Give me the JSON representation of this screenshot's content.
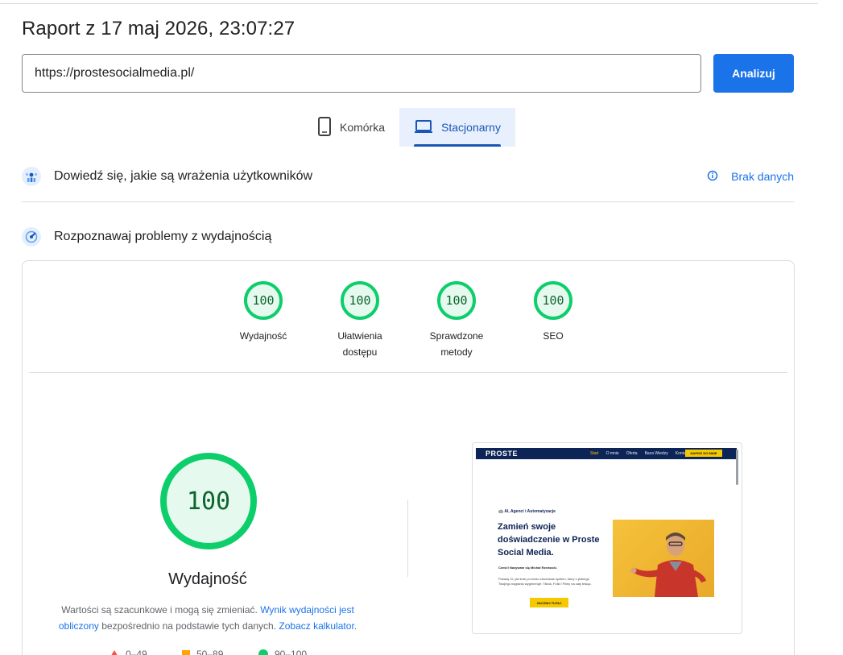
{
  "header": {
    "title": "Raport z 17 maj 2026, 23:07:27"
  },
  "search": {
    "url_value": "https://prostesocialmedia.pl/",
    "analyze_label": "Analizuj"
  },
  "tabs": [
    {
      "label": "Komórka",
      "icon": "phone-icon",
      "active": false
    },
    {
      "label": "Stacjonarny",
      "icon": "laptop-icon",
      "active": true
    }
  ],
  "sections": {
    "field_data": {
      "title": "Dowiedź się, jakie są wrażenia użytkowników",
      "status": "Brak danych"
    },
    "lab_data": {
      "title": "Rozpoznawaj problemy z wydajnością"
    }
  },
  "scores": [
    {
      "value": "100",
      "label_line1": "Wydajność",
      "label_line2": ""
    },
    {
      "value": "100",
      "label_line1": "Ułatwienia",
      "label_line2": "dostępu"
    },
    {
      "value": "100",
      "label_line1": "Sprawdzone",
      "label_line2": "metody"
    },
    {
      "value": "100",
      "label_line1": "SEO",
      "label_line2": ""
    }
  ],
  "performance": {
    "score": "100",
    "label": "Wydajność",
    "desc_prefix": "Wartości są szacunkowe i mogą się zmieniać.",
    "desc_link1": "Wynik wydajności jest obliczony",
    "desc_middle": "bezpośrednio na podstawie tych danych.",
    "desc_link2": "Zobacz kalkulator",
    "desc_suffix": "."
  },
  "legend": [
    {
      "range": "0–49",
      "shape": "triangle",
      "color": "#ff4e42"
    },
    {
      "range": "50–89",
      "shape": "square",
      "color": "#ffa400"
    },
    {
      "range": "90–100",
      "shape": "circle",
      "color": "#0cce6b"
    }
  ],
  "screenshot": {
    "logo": "PROSTE",
    "nav_links": [
      "Start",
      "O mnie",
      "Oferta",
      "Baza Wiedzy",
      "Kontakt"
    ],
    "nav_cta": "NAPISZ DO MNIE",
    "eyebrow": "🤖 AI, Agenci i Automatyzacje",
    "heading": "Zamień swoje doświadczenie w Proste Social Media.",
    "sub": "Cześć! Nazywam się Michał Rzewuski.",
    "body": "Pokażę Ci, jak krok po kroku zbudować system, który z jednego Twojego nagrania wygeneruje: Tiktok, Folki i Filmy na cały tesiąc.",
    "button": "ZACZNIJ TUTAJ"
  },
  "colors": {
    "accent": "#1a73e8",
    "pass": "#0cce6b",
    "pass_text": "#0d652d",
    "active_tab_bg": "#e8f0fe"
  }
}
